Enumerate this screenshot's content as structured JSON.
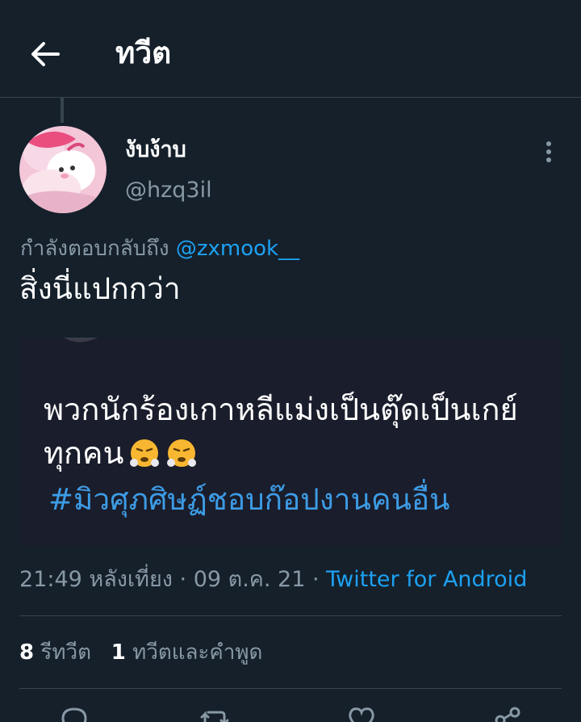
{
  "header": {
    "title": "ทวีต"
  },
  "tweet": {
    "display_name": "งับง้าบ",
    "handle": "@hzq3il",
    "reply_prefix": "กำลังตอบกลับถึง",
    "reply_to": "@zxmook__",
    "text": "สิ่งนี่แปกกว่า",
    "media": {
      "line1": "พวกนักร้องเกาหลีแม่งเป็นตุ๊ดเป็นเกย์",
      "line2": "ทุกคน",
      "line2_emoji": "face-with-steam-from-nose-icon",
      "hashtag": "#มิวศุภศิษฏ์ชอบก๊อปงานคนอื่น"
    },
    "time": "21:49 หลังเที่ยง",
    "date": "09 ต.ค. 21",
    "separator": "·",
    "source": "Twitter for Android"
  },
  "stats": {
    "retweets_count": "8",
    "retweets_label": "รีทวีต",
    "quotes_count": "1",
    "quotes_label": "ทวีตและคำพูด"
  },
  "actions": [
    "reply-icon",
    "retweet-icon",
    "like-icon",
    "share-icon"
  ],
  "colors": {
    "background": "#15202b",
    "accent": "#1da1f2",
    "secondary_text": "#8899a6",
    "divider": "#38444d"
  }
}
